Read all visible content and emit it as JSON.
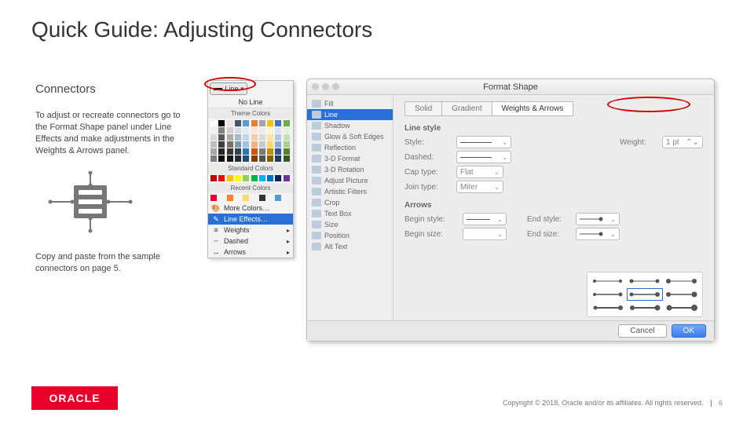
{
  "title": "Quick Guide: Adjusting Connectors",
  "subheading": "Connectors",
  "body1": "To adjust or recreate connectors go to the Format Shape panel under Line Effects and make adjustments in the Weights & Arrows panel.",
  "body2": "Copy and paste from the sample connectors on page 5.",
  "linePanel": {
    "topButton": "Line",
    "noLine": "No Line",
    "themeHeader": "Theme Colors",
    "standardHeader": "Standard Colors",
    "recentHeader": "Recent Colors",
    "moreColors": "More Colors…",
    "lineEffects": "Line Effects…",
    "weights": "Weights",
    "dashed": "Dashed",
    "arrows": "Arrows"
  },
  "formatShape": {
    "title": "Format Shape",
    "sidebar": [
      "Fill",
      "Line",
      "Shadow",
      "Glow & Soft Edges",
      "Reflection",
      "3-D Format",
      "3-D Rotation",
      "Adjust Picture",
      "Artistic Filters",
      "Crop",
      "Text Box",
      "Size",
      "Position",
      "Alt Text"
    ],
    "tabs": [
      "Solid",
      "Gradient",
      "Weights & Arrows"
    ],
    "groups": {
      "lineStyle": "Line style",
      "arrows": "Arrows"
    },
    "labels": {
      "style": "Style:",
      "weight": "Weight:",
      "weightVal": "1 pt",
      "dashed": "Dashed:",
      "capType": "Cap type:",
      "capVal": "Flat",
      "joinType": "Join type:",
      "joinVal": "Miter",
      "beginStyle": "Begin style:",
      "endStyle": "End style:",
      "beginSize": "Begin size:",
      "endSize": "End size:"
    },
    "cancel": "Cancel",
    "ok": "OK"
  },
  "footer": {
    "logo": "ORACLE",
    "copyright": "Copyright © 2018, Oracle and/or its affiliates. All rights reserved.",
    "page": "6"
  },
  "themeSwatches": [
    "#ffffff",
    "#000000",
    "#e7e6e6",
    "#44546a",
    "#5b9bd5",
    "#ed7d31",
    "#a5a5a5",
    "#ffc000",
    "#4472c4",
    "#70ad47",
    "#f2f2f2",
    "#7f7f7f",
    "#d0cece",
    "#d6dce5",
    "#deebf7",
    "#fbe5d6",
    "#ededed",
    "#fff2cc",
    "#dae3f3",
    "#e2f0d9",
    "#d9d9d9",
    "#595959",
    "#aeabab",
    "#adb9ca",
    "#bdd7ee",
    "#f8cbad",
    "#dbdbdb",
    "#ffe699",
    "#b4c7e7",
    "#c5e0b4",
    "#bfbfbf",
    "#3f3f3f",
    "#757070",
    "#8497b0",
    "#9dc3e6",
    "#f4b183",
    "#c9c9c9",
    "#ffd966",
    "#8faadc",
    "#a9d18e",
    "#a6a6a6",
    "#262626",
    "#3a3838",
    "#323f4f",
    "#2e75b6",
    "#c55a11",
    "#7b7b7b",
    "#bf9000",
    "#2f5597",
    "#548235",
    "#7f7f7f",
    "#0d0d0d",
    "#171616",
    "#222a35",
    "#1f4e79",
    "#843c0c",
    "#525252",
    "#806000",
    "#203864",
    "#385723"
  ],
  "standardSwatches": [
    "#c00000",
    "#ff0000",
    "#ffc000",
    "#ffff00",
    "#92d050",
    "#00b050",
    "#00b0f0",
    "#0070c0",
    "#002060",
    "#7030a0"
  ],
  "recentSwatches": [
    "#e8002b",
    "#ff7f27",
    "#ffd966",
    "#333333",
    "#5b9bd5"
  ]
}
